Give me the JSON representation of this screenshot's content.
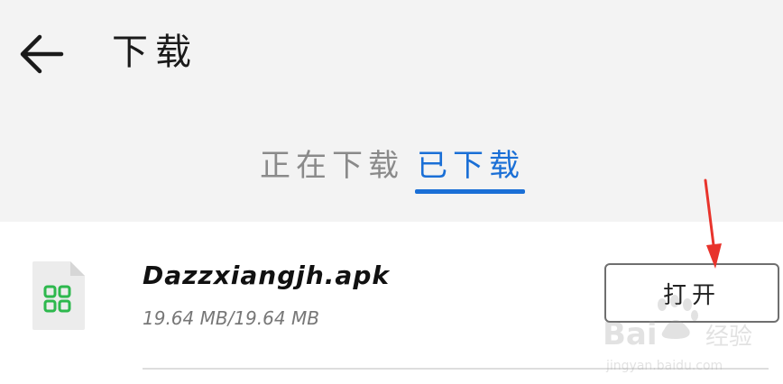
{
  "header": {
    "title": "下载",
    "back_icon": "arrow-left-icon"
  },
  "tabs": [
    {
      "label": "正在下载",
      "active": false
    },
    {
      "label": "已下载",
      "active": true
    }
  ],
  "downloads": [
    {
      "file_name": "Dazzxiangjh.apk",
      "file_size": "19.64 MB/19.64 MB",
      "icon": "apk-file-icon",
      "action_label": "打开"
    }
  ],
  "annotation": {
    "icon": "red-arrow-icon",
    "color": "#e8332b"
  },
  "watermark": {
    "brand": "Baidu经验",
    "url": "jingyan.baidu.com"
  },
  "colors": {
    "accent": "#1a6fd6",
    "header_bg": "#f3f3f3",
    "file_icon_green": "#2db84d"
  }
}
